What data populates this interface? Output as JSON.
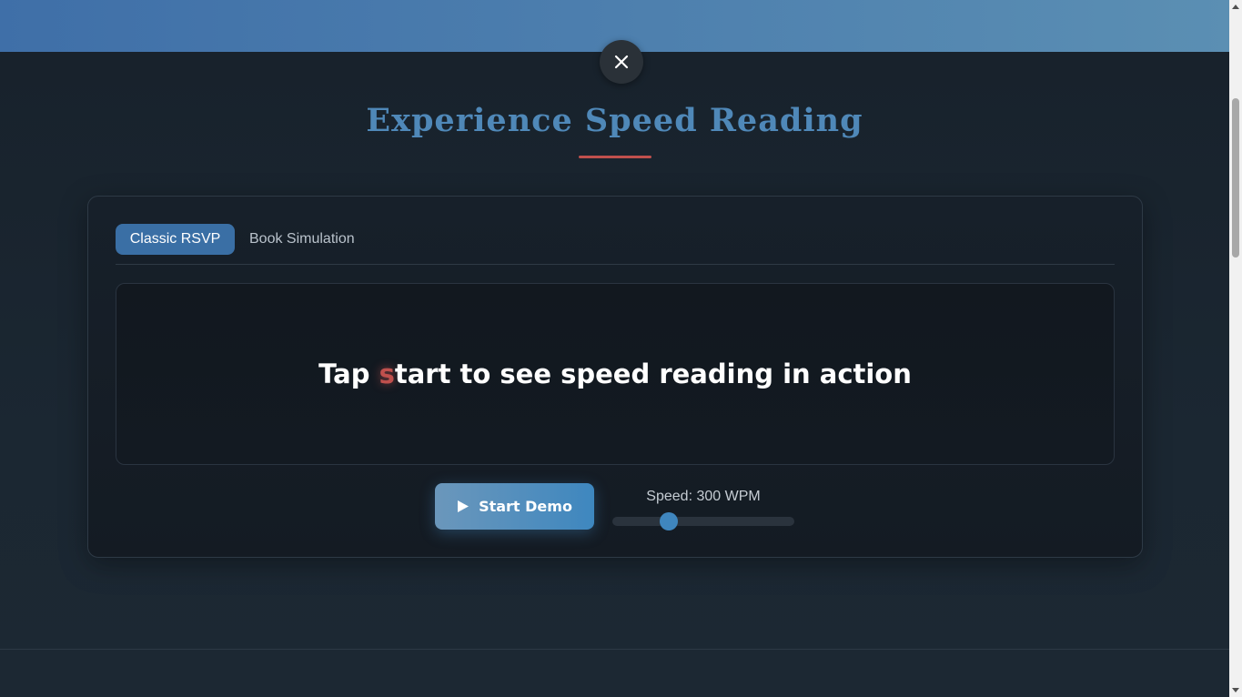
{
  "header": {
    "title": "Experience Speed Reading",
    "close_icon": "close-icon"
  },
  "tabs": [
    {
      "label": "Classic RSVP",
      "active": true
    },
    {
      "label": "Book Simulation",
      "active": false
    }
  ],
  "display": {
    "text_before": "Tap ",
    "focus_letter": "s",
    "text_after": "tart to see speed reading in action"
  },
  "controls": {
    "start_label": "Start Demo",
    "start_icon": "play-icon",
    "speed_label": "Speed: 300 WPM",
    "speed_fraction": 0.31
  },
  "colors": {
    "accent": "#3f86be",
    "title": "#4f88b8",
    "focus": "#c0504d",
    "tab_active": "#3a6fa5"
  }
}
